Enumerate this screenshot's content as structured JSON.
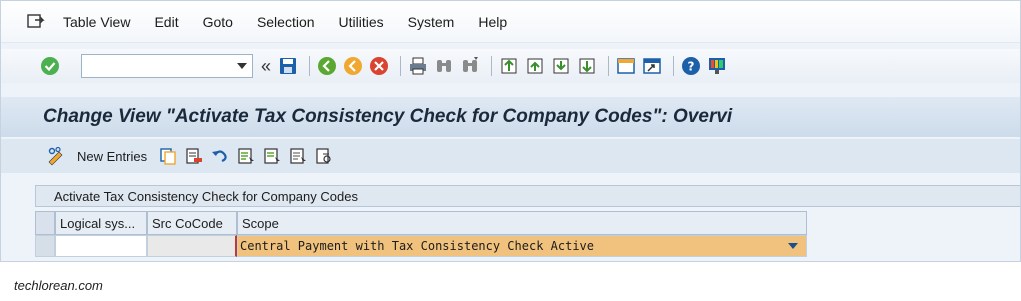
{
  "menubar": {
    "items": [
      "Table View",
      "Edit",
      "Goto",
      "Selection",
      "Utilities",
      "System",
      "Help"
    ]
  },
  "toolbar": {
    "command_field": {
      "value": "",
      "placeholder": ""
    },
    "icons": [
      "enter-check-icon",
      "save-icon",
      "back-icon",
      "exit-icon",
      "cancel-icon",
      "print-icon",
      "find-icon",
      "find-next-icon",
      "first-page-icon",
      "previous-page-icon",
      "next-page-icon",
      "last-page-icon",
      "new-session-icon",
      "shortcut-icon",
      "help-icon",
      "customize-layout-icon"
    ]
  },
  "title": {
    "text": "Change View \"Activate Tax Consistency Check for Company Codes\": Overvi"
  },
  "app_toolbar": {
    "new_entries_label": "New Entries"
  },
  "table": {
    "title": "Activate Tax Consistency Check for Company Codes",
    "columns": [
      "Logical sys...",
      "Src CoCode",
      "Scope"
    ],
    "rows": [
      {
        "logical_system": "",
        "src_cocode": "",
        "scope": "Central Payment with Tax Consistency Check Active"
      }
    ]
  },
  "caption": "techlorean.com",
  "colors": {
    "scope_cell_bg": "#f1c27d",
    "title_band": "#cddbea",
    "frame_bg": "#eef3f9"
  }
}
